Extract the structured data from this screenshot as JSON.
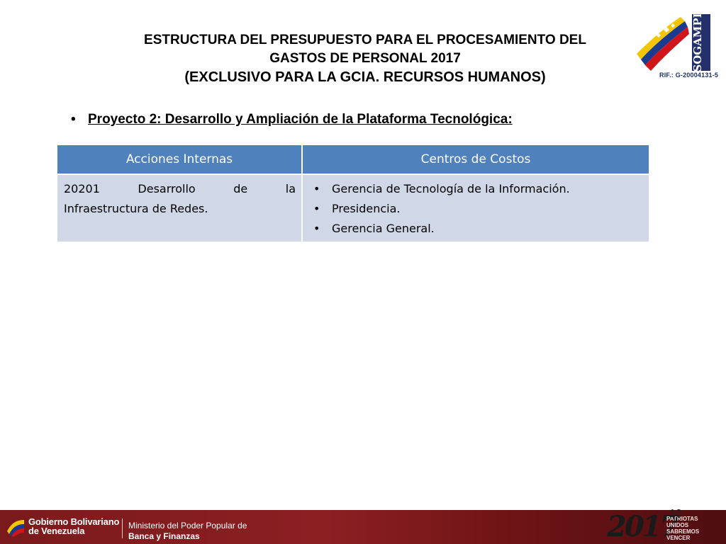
{
  "title": {
    "line1": "ESTRUCTURA DEL PRESUPUESTO PARA EL PROCESAMIENTO DEL",
    "line2": "GASTOS DE PERSONAL 2017",
    "line3": "(EXCLUSIVO PARA LA GCIA. RECURSOS HUMANOS)"
  },
  "logo": {
    "name": "SOGAMPI",
    "rif": "RIF.: G-20004131-5",
    "colors": {
      "yellow": "#f2c500",
      "blue": "#1b3b8f",
      "red": "#d0141a",
      "navy": "#23306a"
    }
  },
  "bullet": {
    "symbol": "•",
    "text": "Proyecto 2:  Desarrollo y Ampliación de la Plataforma Tecnológica:"
  },
  "table": {
    "headers": [
      "Acciones Internas",
      "Centros de Costos"
    ],
    "rows": [
      {
        "action_words": [
          "20201",
          "Desarrollo",
          "de",
          "la"
        ],
        "action_rest": "Infraestructura de Redes.",
        "centers": [
          "Gerencia de Tecnología de la Información.",
          "Presidencia.",
          "Gerencia General."
        ]
      }
    ],
    "colors": {
      "header_bg": "#4f81bd",
      "cell_bg": "#d0d8e8"
    }
  },
  "footer": {
    "gov_line1": "Gobierno Bolivariano",
    "gov_line2": "de Venezuela",
    "ministry_line1": "Ministerio del Poder Popular de",
    "ministry_line2": "Banca y Finanzas",
    "year": "2017",
    "motto_line1": "Patriotas Unidos",
    "motto_line2": "Sabremos Vencer",
    "bg_color": "#8c1f22"
  },
  "page_number": "10"
}
